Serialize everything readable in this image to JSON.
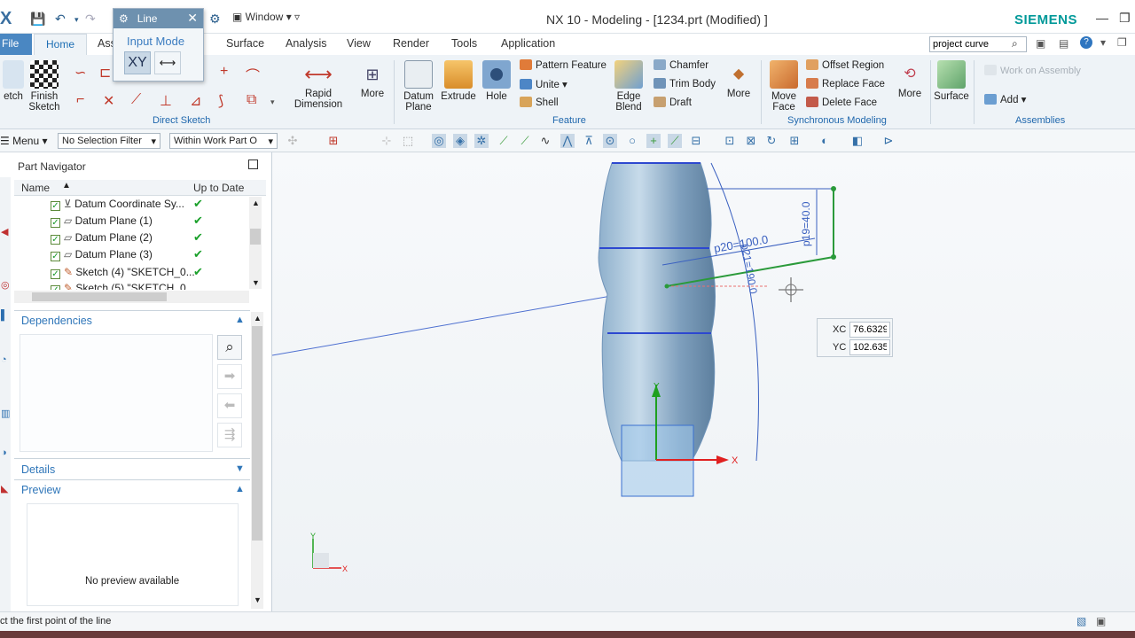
{
  "window": {
    "title": "NX 10 - Modeling - [1234.prt (Modified) ]",
    "brand": "SIEMENS",
    "menu_window": "Window"
  },
  "line_dialog": {
    "title": "Line",
    "input_mode": "Input Mode",
    "xy": "XY"
  },
  "tabs": [
    "File",
    "Home",
    "Ass",
    "Surface",
    "Analysis",
    "View",
    "Render",
    "Tools",
    "Application"
  ],
  "search": {
    "value": "project curve"
  },
  "ribbon": {
    "direct_sketch": {
      "title": "Direct Sketch",
      "sketch": "etch",
      "finish": "Finish Sketch",
      "rapid": "Rapid Dimension",
      "more": "More"
    },
    "feature": {
      "title": "Feature",
      "datum": "Datum Plane",
      "extrude": "Extrude",
      "hole": "Hole",
      "pattern": "Pattern Feature",
      "unite": "Unite",
      "shell": "Shell",
      "edge_blend": "Edge Blend",
      "chamfer": "Chamfer",
      "trim_body": "Trim Body",
      "draft": "Draft",
      "more": "More"
    },
    "sync": {
      "title": "Synchronous Modeling",
      "move_face": "Move Face",
      "offset_region": "Offset Region",
      "replace_face": "Replace Face",
      "delete_face": "Delete Face",
      "more": "More"
    },
    "surface": {
      "label": "Surface"
    },
    "assemblies": {
      "title": "Assemblies",
      "work_on": "Work on Assembly",
      "add": "Add"
    }
  },
  "selbar": {
    "menu": "Menu",
    "filter": "No Selection Filter",
    "scope": "Within Work Part O"
  },
  "navigator": {
    "title": "Part Navigator",
    "col_name": "Name",
    "col_uptodate": "Up to Date",
    "rows": [
      "Datum Coordinate Sy...",
      "Datum Plane (1)",
      "Datum Plane (2)",
      "Datum Plane (3)",
      "Sketch (4) \"SKETCH_0...",
      "Sketch (5) \"SKETCH_0..."
    ],
    "dependencies": "Dependencies",
    "details": "Details",
    "preview": "Preview",
    "no_preview": "No preview available"
  },
  "viewport": {
    "dims": {
      "d20": "p20=100.0",
      "d19": "p19=40.0",
      "d21": "p21=190.0"
    },
    "coords": {
      "xc_label": "XC",
      "xc": "76.6329",
      "yc_label": "YC",
      "yc": "102.635"
    },
    "axis_x": "X",
    "axis_y": "Y"
  },
  "status": "ct the first point of the line"
}
